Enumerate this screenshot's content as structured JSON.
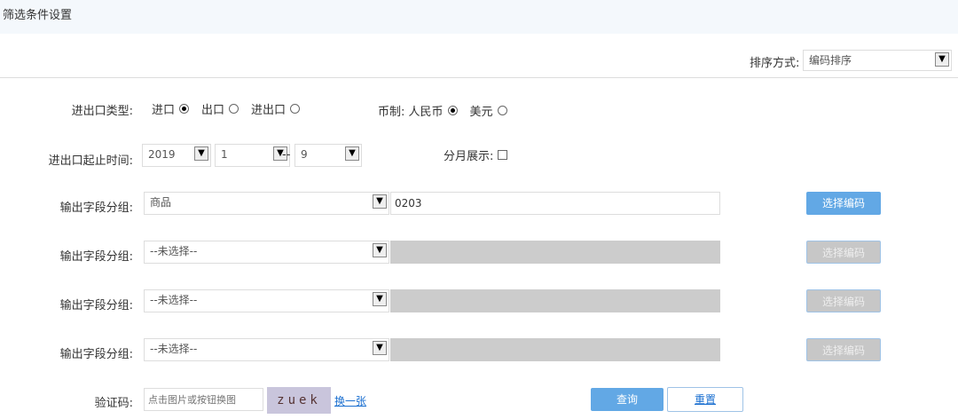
{
  "header": {
    "title": "筛选条件设置"
  },
  "sort": {
    "label": "排序方式:",
    "value": "编码排序"
  },
  "trade_type": {
    "label": "进出口类型:",
    "options": [
      {
        "label": "进口",
        "checked": true
      },
      {
        "label": "出口",
        "checked": false
      },
      {
        "label": "进出口",
        "checked": false
      }
    ]
  },
  "currency": {
    "label": "币制:",
    "options": [
      {
        "label": "人民币",
        "checked": true
      },
      {
        "label": "美元",
        "checked": false
      }
    ]
  },
  "time": {
    "label": "进出口起止时间:",
    "year": "2019",
    "start_month": "1",
    "separator": "--",
    "end_month": "9"
  },
  "monthly": {
    "label": "分月展示:",
    "checked": false
  },
  "groups": [
    {
      "label": "输出字段分组:",
      "select": "商品",
      "code": "0203",
      "button": "选择编码",
      "enabled": true
    },
    {
      "label": "输出字段分组:",
      "select": "--未选择--",
      "code": "",
      "button": "选择编码",
      "enabled": false
    },
    {
      "label": "输出字段分组:",
      "select": "--未选择--",
      "code": "",
      "button": "选择编码",
      "enabled": false
    },
    {
      "label": "输出字段分组:",
      "select": "--未选择--",
      "code": "",
      "button": "选择编码",
      "enabled": false
    }
  ],
  "captcha": {
    "label": "验证码:",
    "placeholder": "点击图片或按钮换图",
    "image_text": "zuek",
    "refresh": "换一张"
  },
  "actions": {
    "query": "查询",
    "reset": "重置"
  },
  "colors": {
    "accent": "#62a8e5",
    "header_bg": "#f4f8fc",
    "link": "#1a6fd0"
  }
}
